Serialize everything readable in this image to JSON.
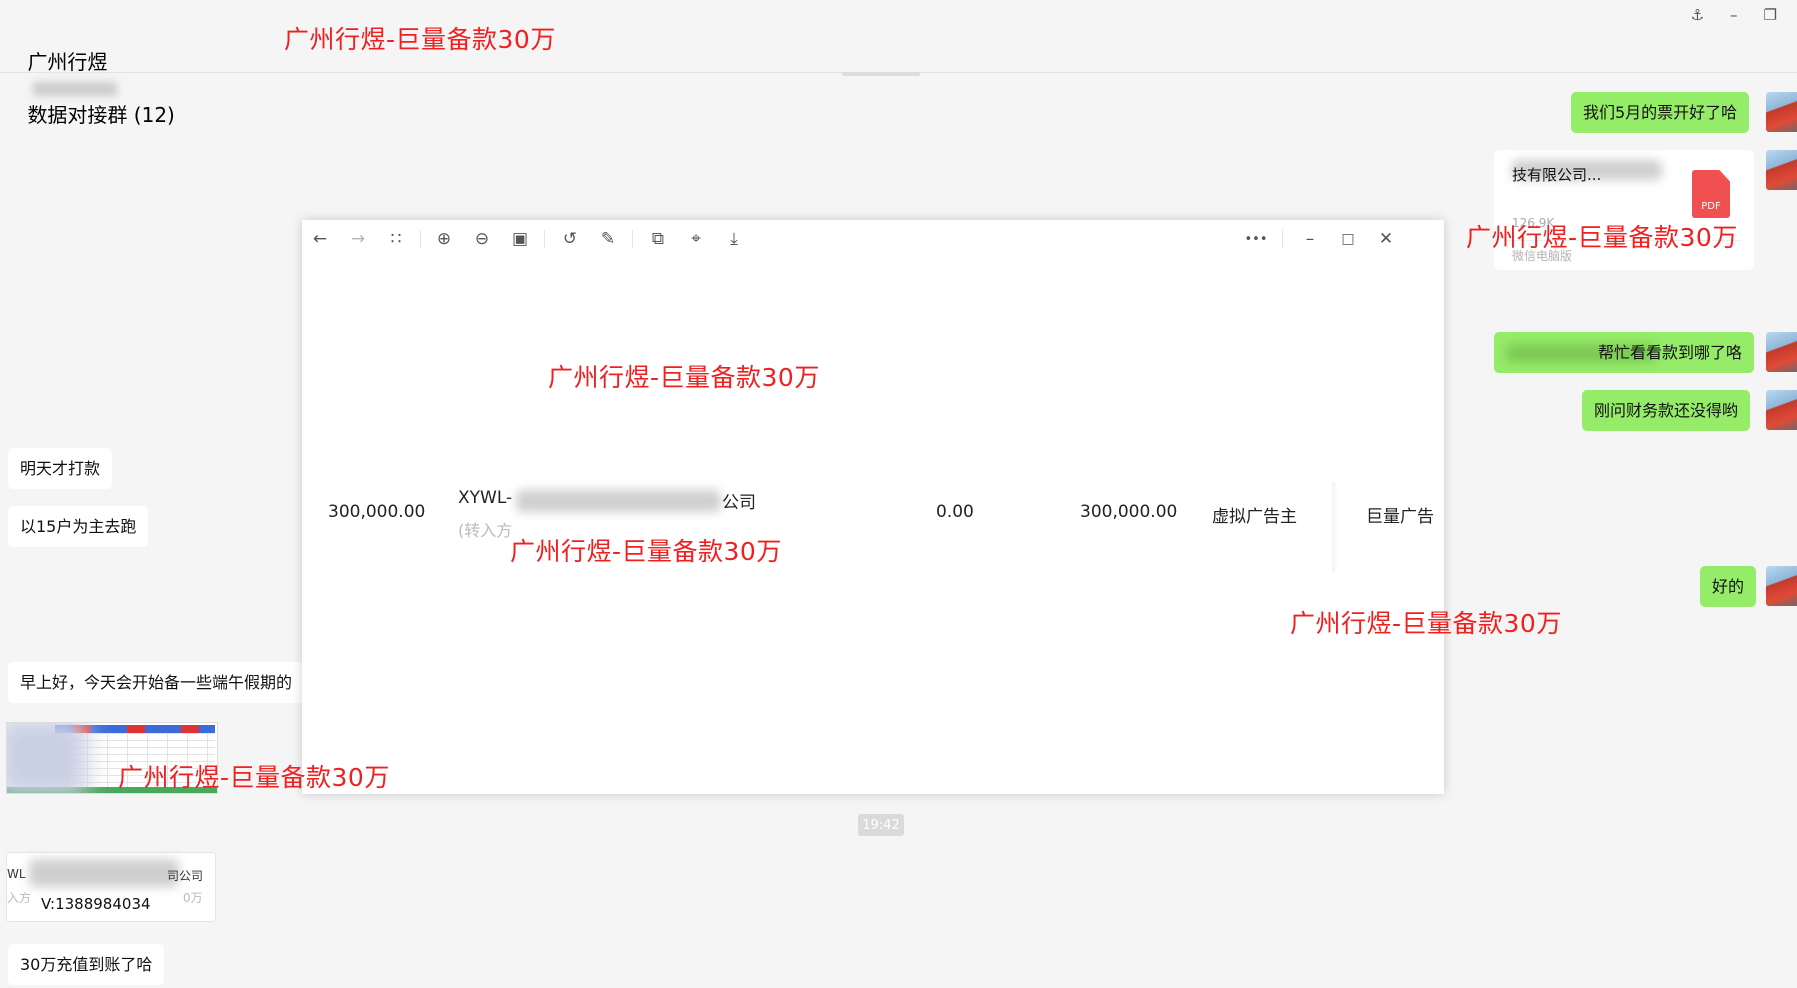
{
  "header": {
    "group_title_prefix": "广州行煜",
    "group_title_suffix": "数据对接群 (12)",
    "pin_icon": "pin-icon",
    "minimize_icon": "minimize-icon",
    "restore_icon": "restore-icon"
  },
  "watermark_text": "广州行煜-巨量备款30万",
  "messages_right": {
    "invoice": "我们5月的票开好了哈",
    "check_payment": "帮忙看看款到哪了咯",
    "finance": "刚问财务款还没得哟",
    "ok": "好的"
  },
  "file_card": {
    "name": "技有限公司...",
    "size": "126.9K",
    "footer": "微信电脑版",
    "badge": "PDF"
  },
  "messages_left": {
    "pay_tomorrow": "明天才打款",
    "main_run": "以15户为主去跑",
    "morning": "早上好，今天会开始备一些端午假期的",
    "transfer_prefix": "WL",
    "transfer_company_tail": "司公司",
    "transfer_sub_prefix": "入方",
    "transfer_amount_tail": "0万",
    "contact": "V:1388984034",
    "arrived": "30万充值到账了哈"
  },
  "time_chip": "19:42",
  "viewer": {
    "amount": "300,000.00",
    "company_prefix": "XYWL-",
    "company_suffix": "公司",
    "transfer_in": "(转入方",
    "zero": "0.00",
    "amount2": "300,000.00",
    "advertiser": "虚拟广告主",
    "platform": "巨量广告",
    "more_label": "•••"
  }
}
